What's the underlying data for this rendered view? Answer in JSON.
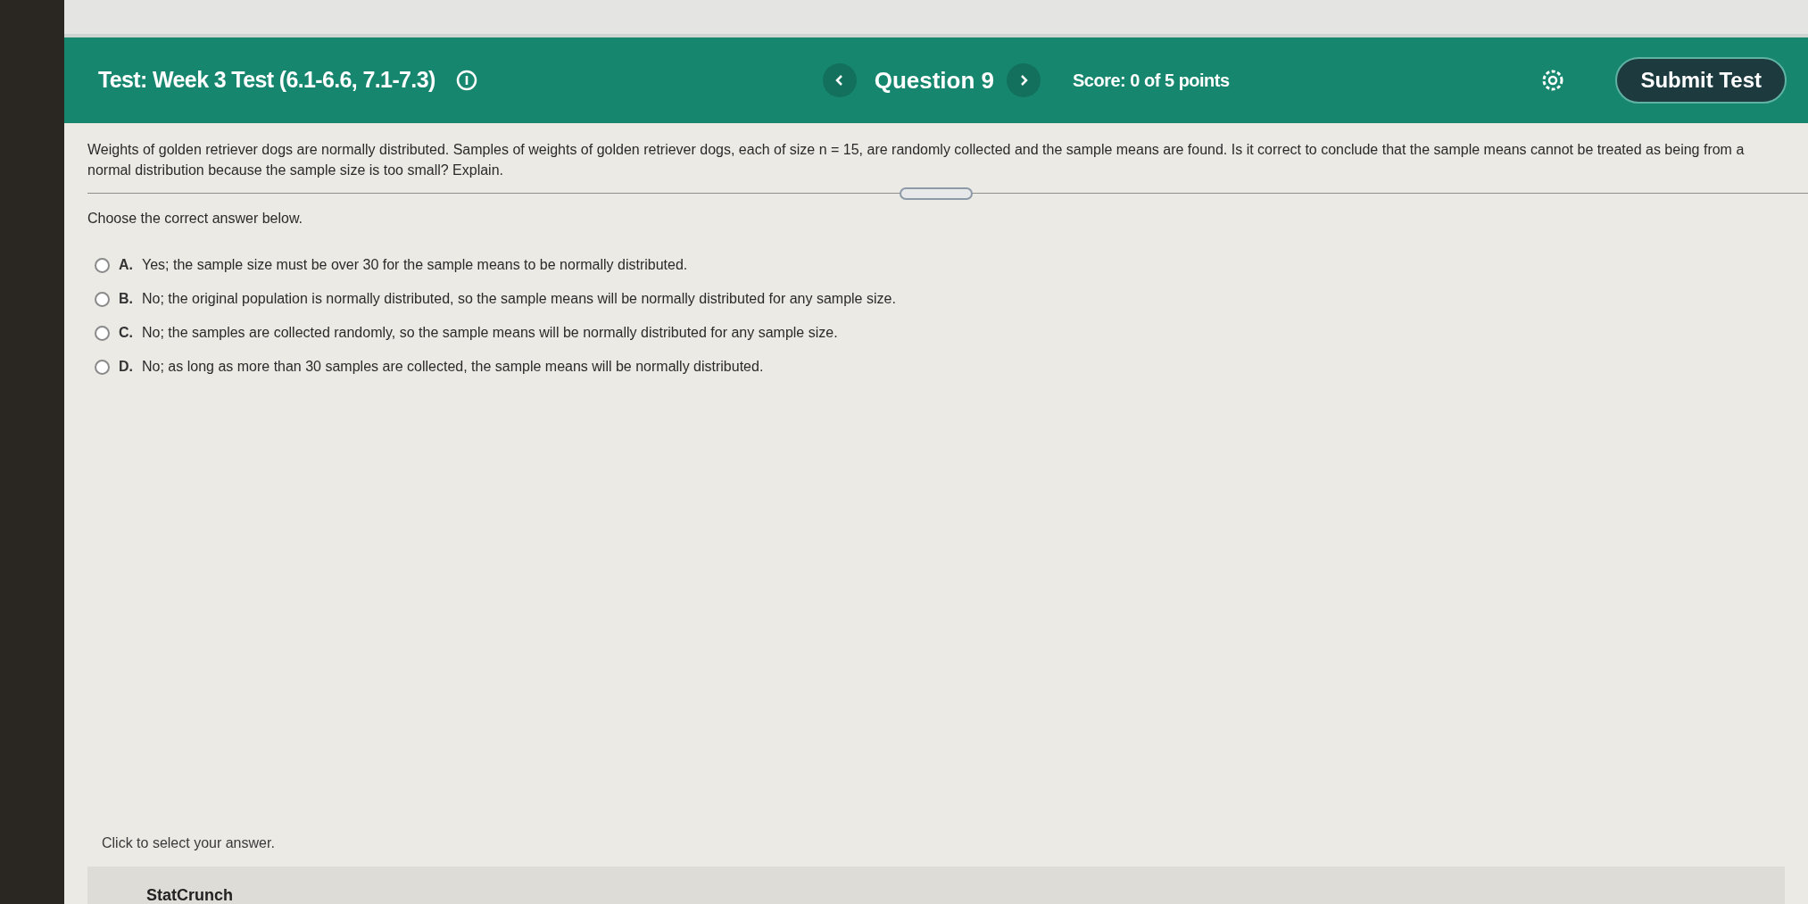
{
  "header": {
    "title": "Test: Week 3 Test (6.1-6.6, 7.1-7.3)",
    "question": "Question 9",
    "score": "Score: 0 of 5 points",
    "submit": "Submit Test"
  },
  "question": {
    "text": "Weights of golden retriever dogs are normally distributed. Samples of weights of golden retriever dogs, each of size n = 15, are randomly collected and the sample means are found. Is it correct to conclude that the sample means cannot be treated as being from a normal distribution because the sample size is too small? Explain.",
    "prompt": "Choose the correct answer below.",
    "options": [
      {
        "letter": "A.",
        "text": "Yes; the sample size must be over 30 for the sample means to be normally distributed.",
        "selected": false
      },
      {
        "letter": "B.",
        "text": "No; the original population is normally distributed, so the sample means will be normally distributed for any sample size.",
        "selected": false
      },
      {
        "letter": "C.",
        "text": "No; the samples are collected randomly, so the sample means will be normally distributed for any sample size.",
        "selected": false
      },
      {
        "letter": "D.",
        "text": "No; as long as more than 30 samples are collected, the sample means will be normally distributed.",
        "selected": false
      }
    ]
  },
  "hint": "Click to select your answer.",
  "footer": {
    "tool": "StatCrunch"
  }
}
